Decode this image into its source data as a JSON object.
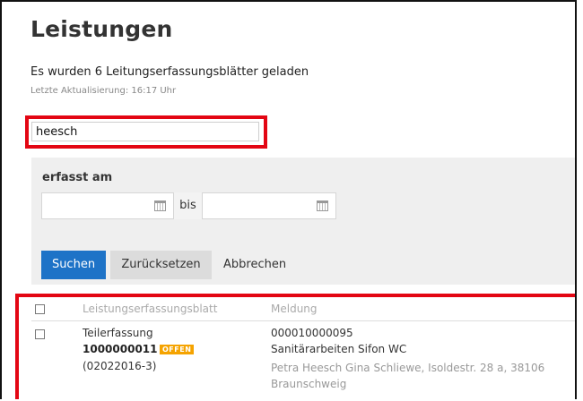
{
  "page": {
    "title": "Leistungen",
    "info": "Es wurden 6 Leitungserfassungsblätter geladen",
    "updated": "Letzte Aktualisierung: 16:17 Uhr"
  },
  "search": {
    "value": "heesch"
  },
  "filter": {
    "label": "erfasst am",
    "between": "bis",
    "from_value": "",
    "to_value": ""
  },
  "buttons": {
    "search": "Suchen",
    "reset": "Zurücksetzen",
    "cancel": "Abbrechen"
  },
  "table": {
    "columns": [
      "Leistungserfassungsblatt",
      "Meldung"
    ],
    "rows": [
      {
        "type": "Teilerfassung",
        "number": "1000000011",
        "status": "OFFEN",
        "reference": "(02022016-3)",
        "meldung_number": "000010000095",
        "meldung_title": "Sanitärarbeiten Sifon WC",
        "meldung_person": "Petra Heesch Gina Schliewe, Isoldestr. 28 a, 38106 Braunschweig"
      }
    ]
  },
  "colors": {
    "highlight": "#e30613",
    "primary_button": "#1e73c7",
    "badge": "#f5a300"
  }
}
